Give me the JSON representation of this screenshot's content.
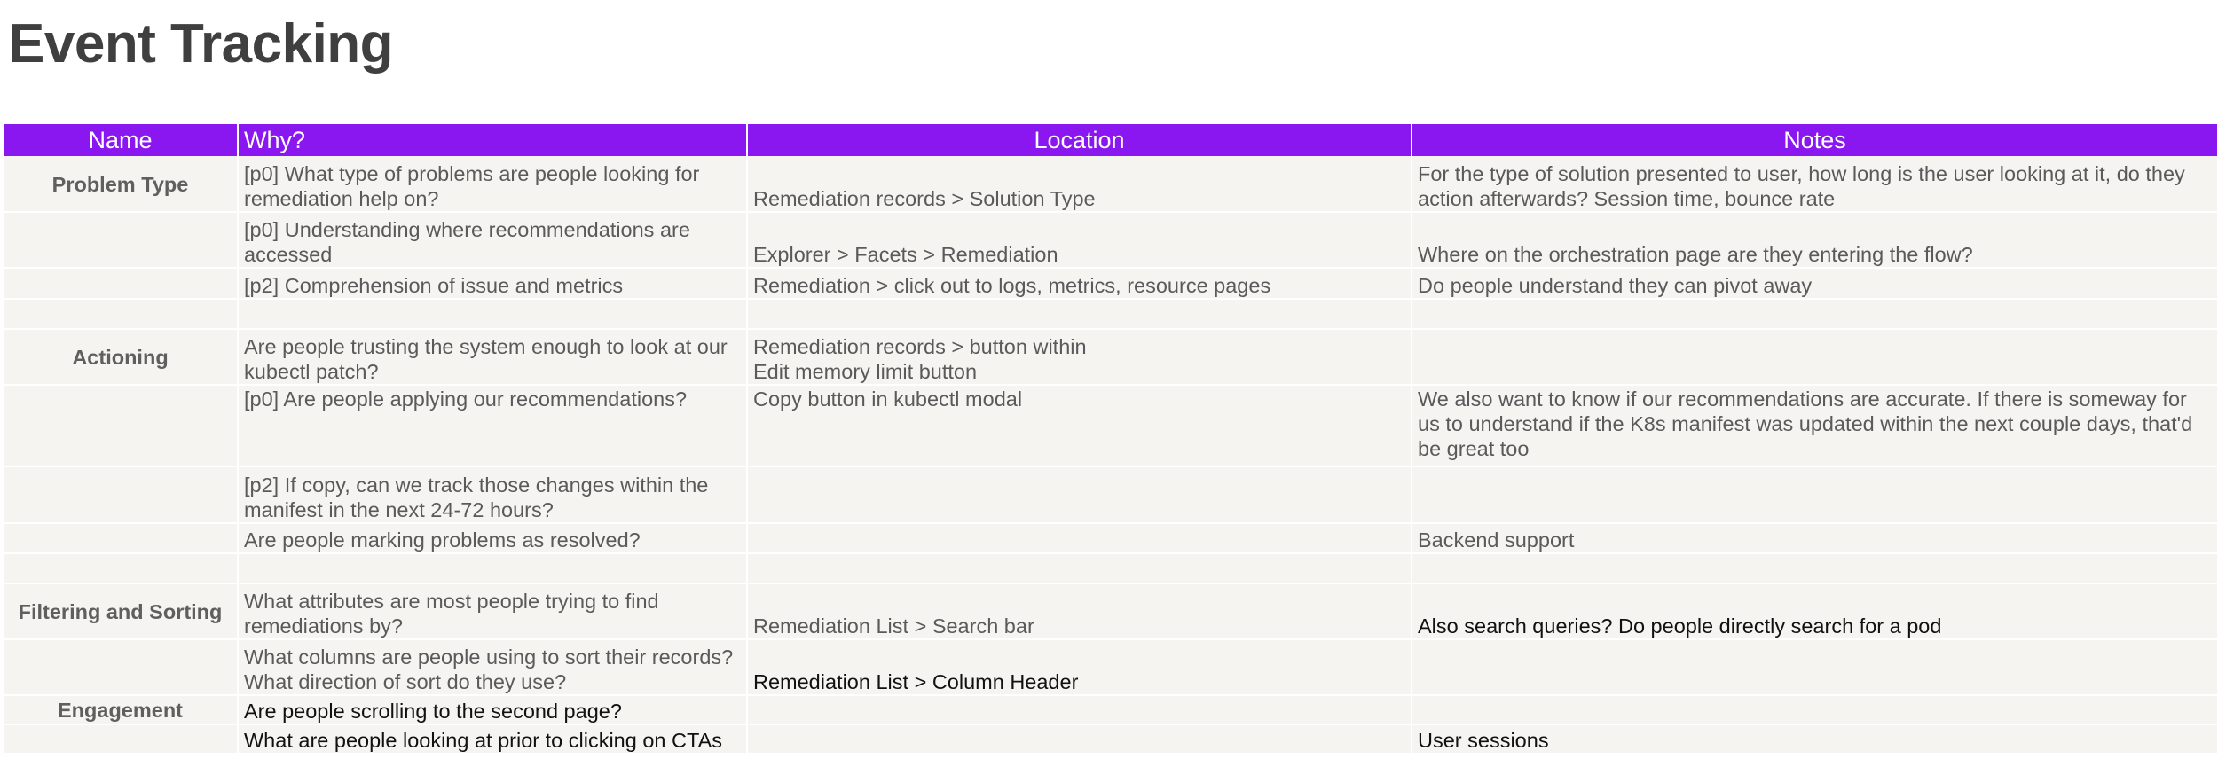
{
  "page": {
    "title": "Event Tracking"
  },
  "colors": {
    "header_bg": "#8a17f0",
    "header_text": "#ffffff",
    "cell_bg": "#f5f4f1",
    "title_text": "#3f3f3f"
  },
  "table": {
    "headers": {
      "name": "Name",
      "why": "Why?",
      "location": "Location",
      "notes": "Notes"
    },
    "rows": [
      {
        "name": "Problem Type",
        "why": "[p0] What type of problems are people looking for remediation help on?",
        "location": "Remediation records > Solution Type",
        "notes": "For the type of solution presented to user, how long is the user looking at it, do they action afterwards? Session time, bounce rate"
      },
      {
        "name": "",
        "why": "[p0] Understanding where recommendations are accessed",
        "location": "Explorer > Facets > Remediation",
        "notes": "Where on the orchestration page are they entering the flow?"
      },
      {
        "name": "",
        "why": "[p2] Comprehension of issue and metrics",
        "location": "Remediation > click out to logs, metrics, resource pages",
        "notes": "Do people understand they can pivot away"
      },
      {
        "name": "",
        "why": "",
        "location": "",
        "notes": ""
      },
      {
        "name": "Actioning",
        "why": "Are people trusting the system enough to look at our kubectl patch?",
        "location_line1": "Remediation records > button within",
        "location_line2": "Edit memory limit button",
        "notes": ""
      },
      {
        "name": "",
        "why": "[p0] Are people applying our recommendations?",
        "location": "Copy button in kubectl modal",
        "notes": "We also want to know if our recommendations are accurate. If there is someway for us to understand if the K8s manifest was updated within the next couple days, that'd be great too"
      },
      {
        "name": "",
        "why": "[p2] If copy, can we track those changes within the manifest in the next 24-72 hours?",
        "location": "",
        "notes": ""
      },
      {
        "name": "",
        "why": "Are people marking problems as resolved?",
        "location": "",
        "notes": "Backend support"
      },
      {
        "name": "",
        "why": "",
        "location": "",
        "notes": ""
      },
      {
        "name": "Filtering and Sorting",
        "why": "What attributes are most people trying to find remediations by?",
        "location": "Remediation List > Search bar",
        "notes": "Also search queries? Do people directly search for a pod"
      },
      {
        "name": "",
        "why": "What columns are people using to sort their records? What direction of sort do they use?",
        "location": "Remediation List > Column Header",
        "notes": ""
      },
      {
        "name": "Engagement",
        "why": "Are people scrolling to the second page?",
        "location": "",
        "notes": ""
      },
      {
        "name": "",
        "why": "What are people looking at prior to clicking on CTAs",
        "location": "",
        "notes": "User sessions"
      }
    ]
  }
}
